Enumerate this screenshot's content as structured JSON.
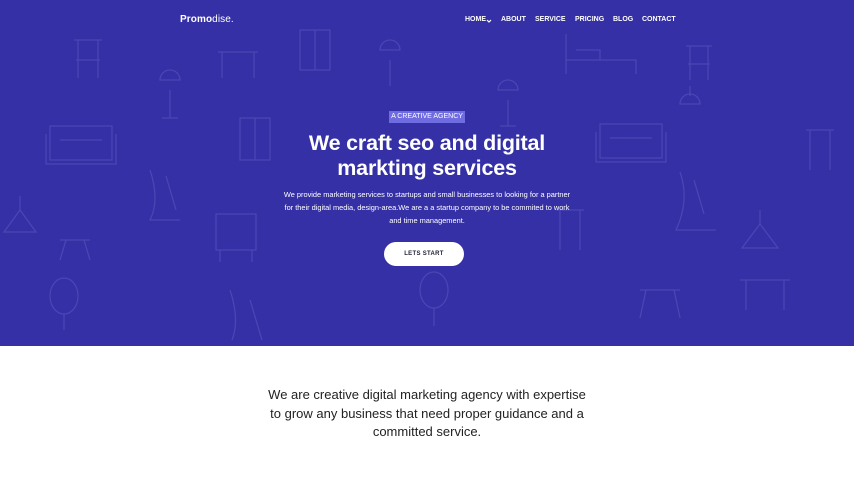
{
  "brand": {
    "name_bold": "Promo",
    "name_light": "dise."
  },
  "nav": {
    "items": [
      {
        "label": "HOME",
        "has_dropdown": true
      },
      {
        "label": "ABOUT"
      },
      {
        "label": "SERVICE"
      },
      {
        "label": "PRICING"
      },
      {
        "label": "BLOG"
      },
      {
        "label": "CONTACT"
      }
    ]
  },
  "hero": {
    "badge": "A CREATIVE AGENCY",
    "headline": [
      "We craft seo and digital",
      "markting services"
    ],
    "description": [
      "We provide marketing services to startups and small businesses to looking for a partner",
      "for their digital media, design-area.We are a a startup company to be commited to work",
      "and time management."
    ],
    "cta_label": "LETS START",
    "pattern_icons": [
      "chair-icon",
      "table-icon",
      "lamp-icon",
      "sofa-icon",
      "cabinet-icon",
      "bed-icon",
      "armchair-icon",
      "stool-icon"
    ]
  },
  "about": {
    "text": [
      "We are creative digital marketing agency with expertise",
      "to grow any business that need proper guidance and a",
      "committed service."
    ]
  },
  "colors": {
    "hero_background": "#3530a6",
    "pattern_stroke": "#4a46b4",
    "badge_background": "#6f6be0",
    "text_light": "#ffffff",
    "text_dark": "#222222"
  }
}
